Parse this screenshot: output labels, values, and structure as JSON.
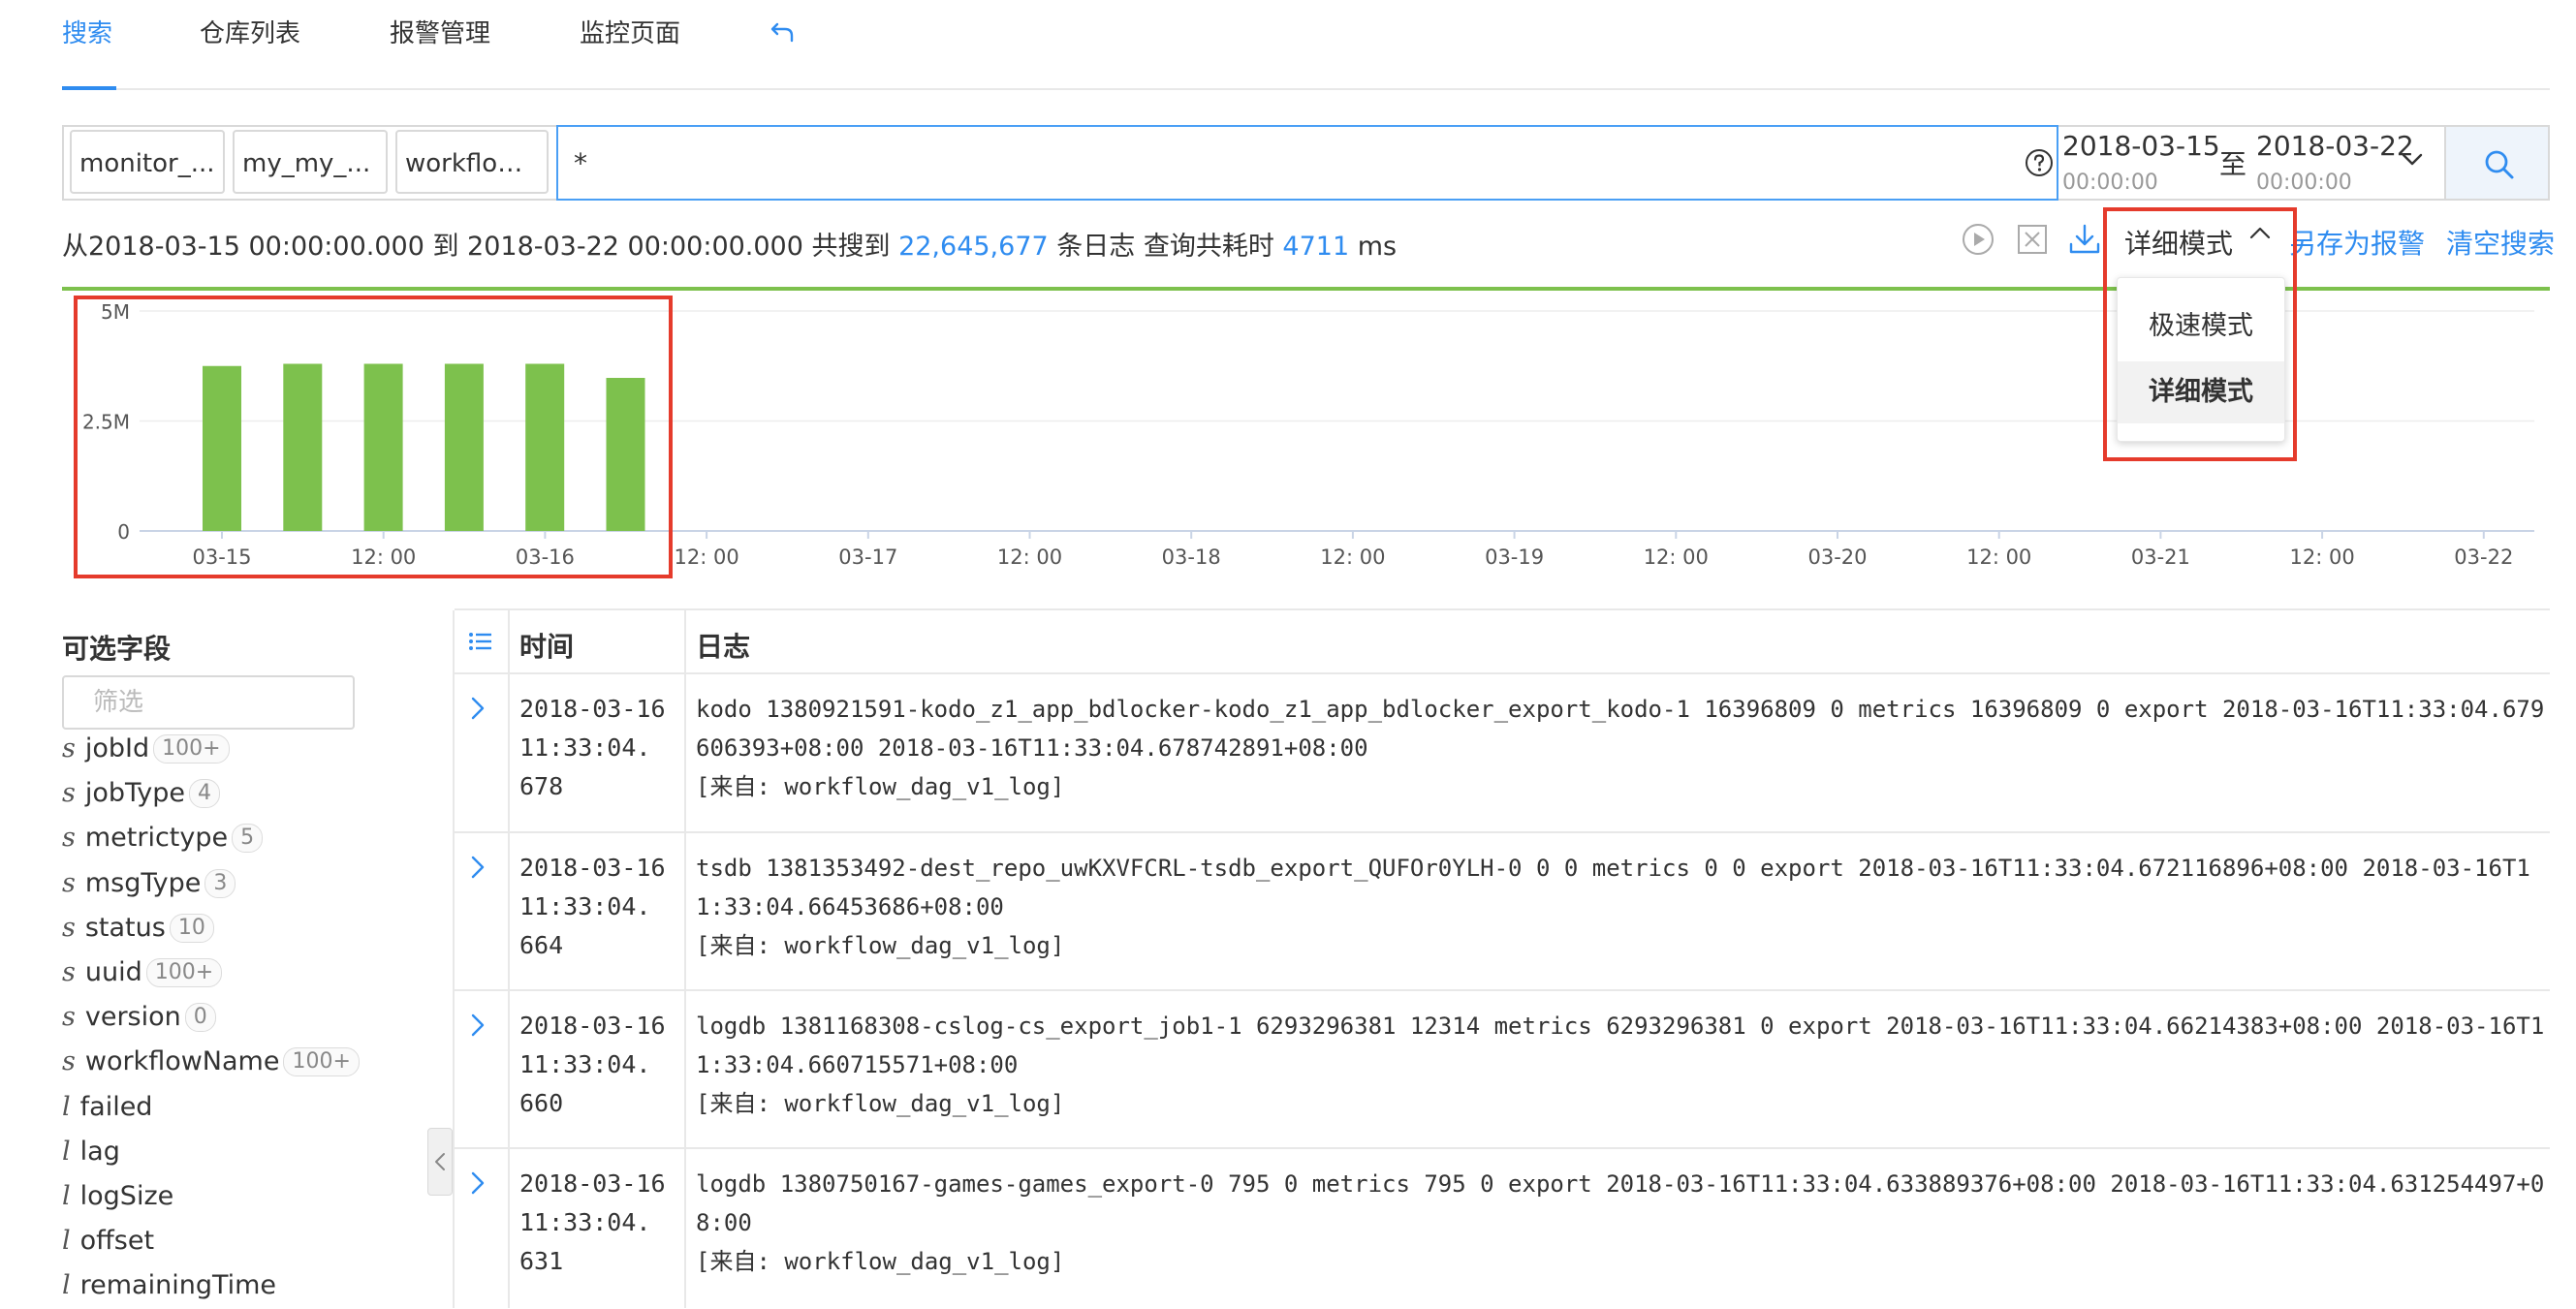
{
  "tabs": [
    {
      "label": "搜索",
      "active": true
    },
    {
      "label": "仓库列表",
      "active": false
    },
    {
      "label": "报警管理",
      "active": false
    },
    {
      "label": "监控页面",
      "active": false
    }
  ],
  "search": {
    "repos": [
      "monitor_...",
      "my_my_...",
      "workflow..."
    ],
    "query": "*",
    "date_from": "2018-03-15",
    "time_from": "00:00:00",
    "date_sep": "至",
    "date_to": "2018-03-22",
    "time_to": "00:00:00"
  },
  "summary": {
    "prefix": "从2018-03-15 00:00:00.000 到 2018-03-22 00:00:00.000 共搜到 ",
    "count": "22,645,677",
    "mid": " 条日志 查询共耗时 ",
    "ms": "4711",
    "suffix": " ms"
  },
  "toolbar": {
    "mode": "详细模式",
    "save_alert": "另存为报警",
    "clear_search": "清空搜索"
  },
  "mode_dropdown": {
    "options": [
      "极速模式",
      "详细模式"
    ],
    "selected": "详细模式"
  },
  "colors": {
    "accent": "#2f8cf0",
    "bar": "#7dc14d",
    "highlight_box": "#e53b2c"
  },
  "chart_data": {
    "type": "bar",
    "y_ticks": [
      "5M",
      "2.5M",
      "0"
    ],
    "ylim": [
      0,
      5000000
    ],
    "x_tick_labels": [
      "03-15",
      "12: 00",
      "03-16",
      "12: 00",
      "03-17",
      "12: 00",
      "03-18",
      "12: 00",
      "03-19",
      "12: 00",
      "03-20",
      "12: 00",
      "03-21",
      "12: 00",
      "03-22"
    ],
    "values": [
      3750000,
      3800000,
      3800000,
      3800000,
      3800000,
      3480000
    ]
  },
  "sidebar": {
    "title": "可选字段",
    "filter_placeholder": "筛选",
    "fields": [
      {
        "type": "s",
        "name": "jobId",
        "count": "100+"
      },
      {
        "type": "s",
        "name": "jobType",
        "count": "4"
      },
      {
        "type": "s",
        "name": "metrictype",
        "count": "5"
      },
      {
        "type": "s",
        "name": "msgType",
        "count": "3"
      },
      {
        "type": "s",
        "name": "status",
        "count": "10"
      },
      {
        "type": "s",
        "name": "uuid",
        "count": "100+"
      },
      {
        "type": "s",
        "name": "version",
        "count": "0"
      },
      {
        "type": "s",
        "name": "workflowName",
        "count": "100+"
      },
      {
        "type": "l",
        "name": "failed",
        "count": ""
      },
      {
        "type": "l",
        "name": "lag",
        "count": ""
      },
      {
        "type": "l",
        "name": "logSize",
        "count": ""
      },
      {
        "type": "l",
        "name": "offset",
        "count": ""
      },
      {
        "type": "l",
        "name": "remainingTime",
        "count": ""
      }
    ]
  },
  "table": {
    "col_time": "时间",
    "col_log": "日志",
    "rows": [
      {
        "time": [
          "2018-03-16",
          "11:33:04.",
          "678"
        ],
        "log": "kodo 1380921591-kodo_z1_app_bdlocker-kodo_z1_app_bdlocker_export_kodo-1 16396809 0 metrics 16396809 0 export 2018-03-16T11:33:04.679606393+08:00 2018-03-16T11:33:04.678742891+08:00",
        "source": "[来自: workflow_dag_v1_log]"
      },
      {
        "time": [
          "2018-03-16",
          "11:33:04.",
          "664"
        ],
        "log": "tsdb 1381353492-dest_repo_uwKXVFCRL-tsdb_export_QUFOr0YLH-0 0 0 metrics 0 0 export 2018-03-16T11:33:04.672116896+08:00 2018-03-16T11:33:04.66453686+08:00",
        "source": "[来自: workflow_dag_v1_log]"
      },
      {
        "time": [
          "2018-03-16",
          "11:33:04.",
          "660"
        ],
        "log": "logdb 1381168308-cslog-cs_export_job1-1 6293296381 12314 metrics 6293296381 0 export 2018-03-16T11:33:04.66214383+08:00 2018-03-16T11:33:04.660715571+08:00",
        "source": "[来自: workflow_dag_v1_log]"
      },
      {
        "time": [
          "2018-03-16",
          "11:33:04.",
          "631"
        ],
        "log": "logdb 1380750167-games-games_export-0 795 0 metrics 795 0 export 2018-03-16T11:33:04.633889376+08:00 2018-03-16T11:33:04.631254497+08:00",
        "source": "[来自: workflow_dag_v1_log]"
      }
    ]
  }
}
